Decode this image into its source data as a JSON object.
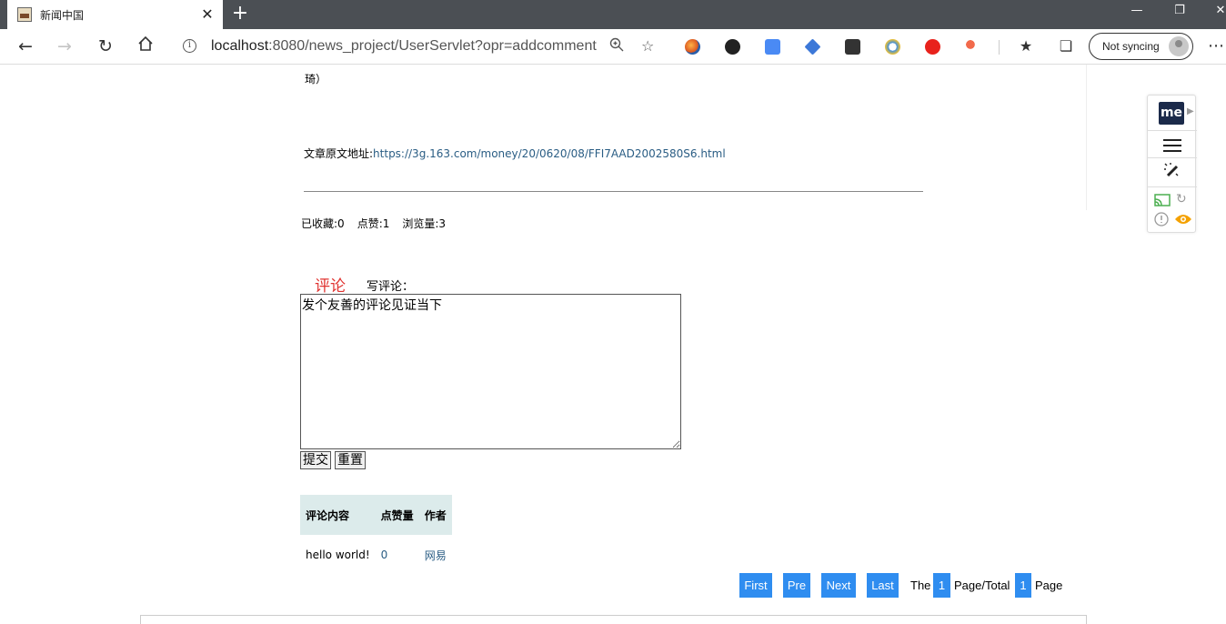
{
  "browser": {
    "tab_title": "新闻中国",
    "tab_close": "✕",
    "new_tab": "+",
    "url_host": "localhost",
    "url_path": ":8080/news_project/UserServlet?opr=addcomment",
    "sync_label": "Not syncing",
    "more_label": "⋯",
    "icons": [
      "back-icon",
      "forward-icon",
      "refresh-icon",
      "home-icon",
      "info-icon",
      "zoom-icon",
      "favorite-star-icon",
      "collections-icon"
    ]
  },
  "article": {
    "tail_text": "琦）",
    "source_label": "文章原文地址:",
    "source_url": "https://3g.163.com/money/20/0620/08/FFI7AAD2002580S6.html"
  },
  "stats": {
    "favorites": "已收藏:0",
    "likes": "点赞:1",
    "views": "浏览量:3"
  },
  "comment_form": {
    "heading": "评论",
    "write_label": "写评论：",
    "placeholder": "发个友善的评论见证当下",
    "submit_label": "提交",
    "reset_label": "重置"
  },
  "comments_table": {
    "headers": [
      "评论内容",
      "点赞量",
      "作者"
    ],
    "rows": [
      {
        "content": "hello world!",
        "likes": "0",
        "author": "网易"
      }
    ]
  },
  "pager": {
    "first": "First",
    "pre": "Pre",
    "next": "Next",
    "last": "Last",
    "the": "The",
    "current_page": "1",
    "page_total": "Page/Total",
    "total_pages": "1",
    "page": "Page"
  },
  "colors": {
    "accent": "#2f8df0",
    "comment_heading": "#e0322f",
    "table_header_bg": "#dcebeb",
    "link": "#2a5d84"
  }
}
